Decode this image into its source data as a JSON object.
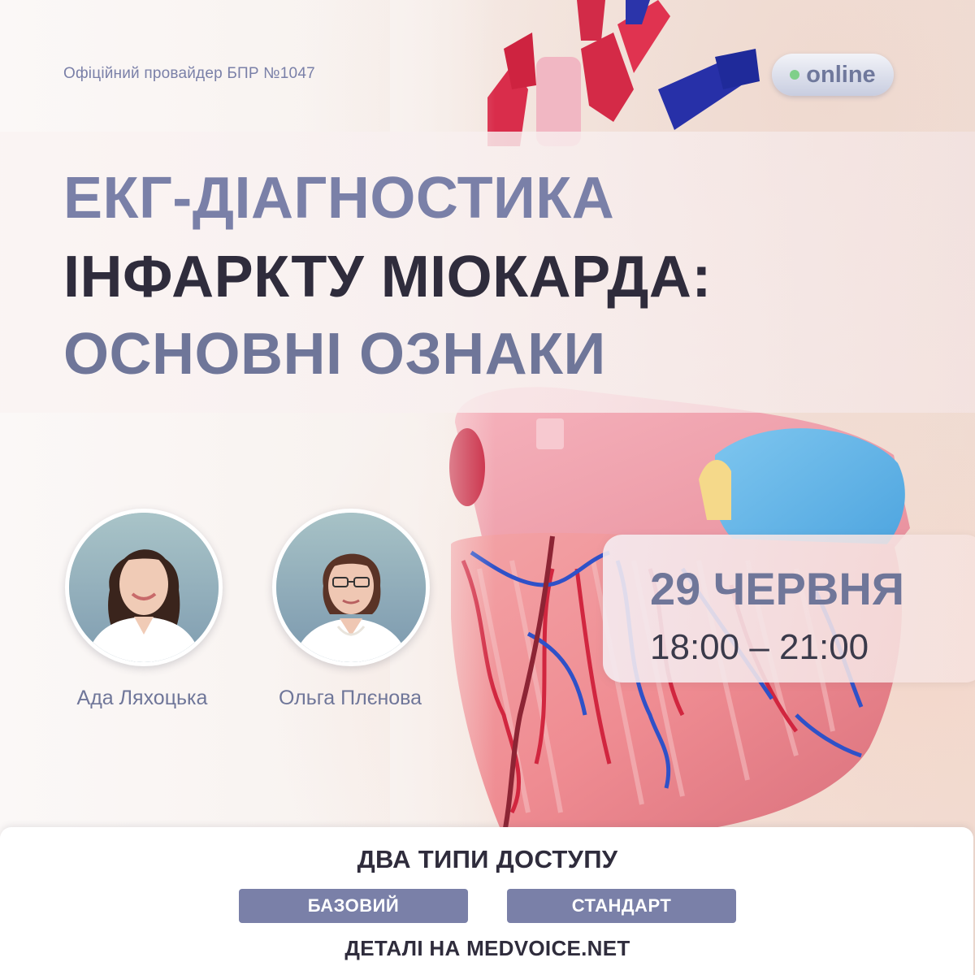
{
  "provider": "Офіційний провайдер БПР №1047",
  "badge": {
    "label": "online",
    "icon": "status-dot-icon",
    "dot_color": "#7fcf8a"
  },
  "title": {
    "line1": "ЕКГ-ДІАГНОСТИКА",
    "line2": "ІНФАРКТУ МІОКАРДА:",
    "line3": "ОСНОВНІ ОЗНАКИ"
  },
  "speakers": [
    {
      "name": "Ада Ляхоцька"
    },
    {
      "name": "Ольга Плєнова"
    }
  ],
  "event": {
    "date": "29 ЧЕРВНЯ",
    "time": "18:00 – 21:00"
  },
  "access": {
    "title": "ДВА ТИПИ ДОСТУПУ",
    "options": [
      "БАЗОВИЙ",
      "СТАНДАРТ"
    ],
    "details": "ДЕТАЛІ НА MEDVOICE.NET"
  },
  "colors": {
    "accent": "#7a80a8",
    "dark": "#2f2c3c",
    "button_bg": "#7a80a8"
  }
}
